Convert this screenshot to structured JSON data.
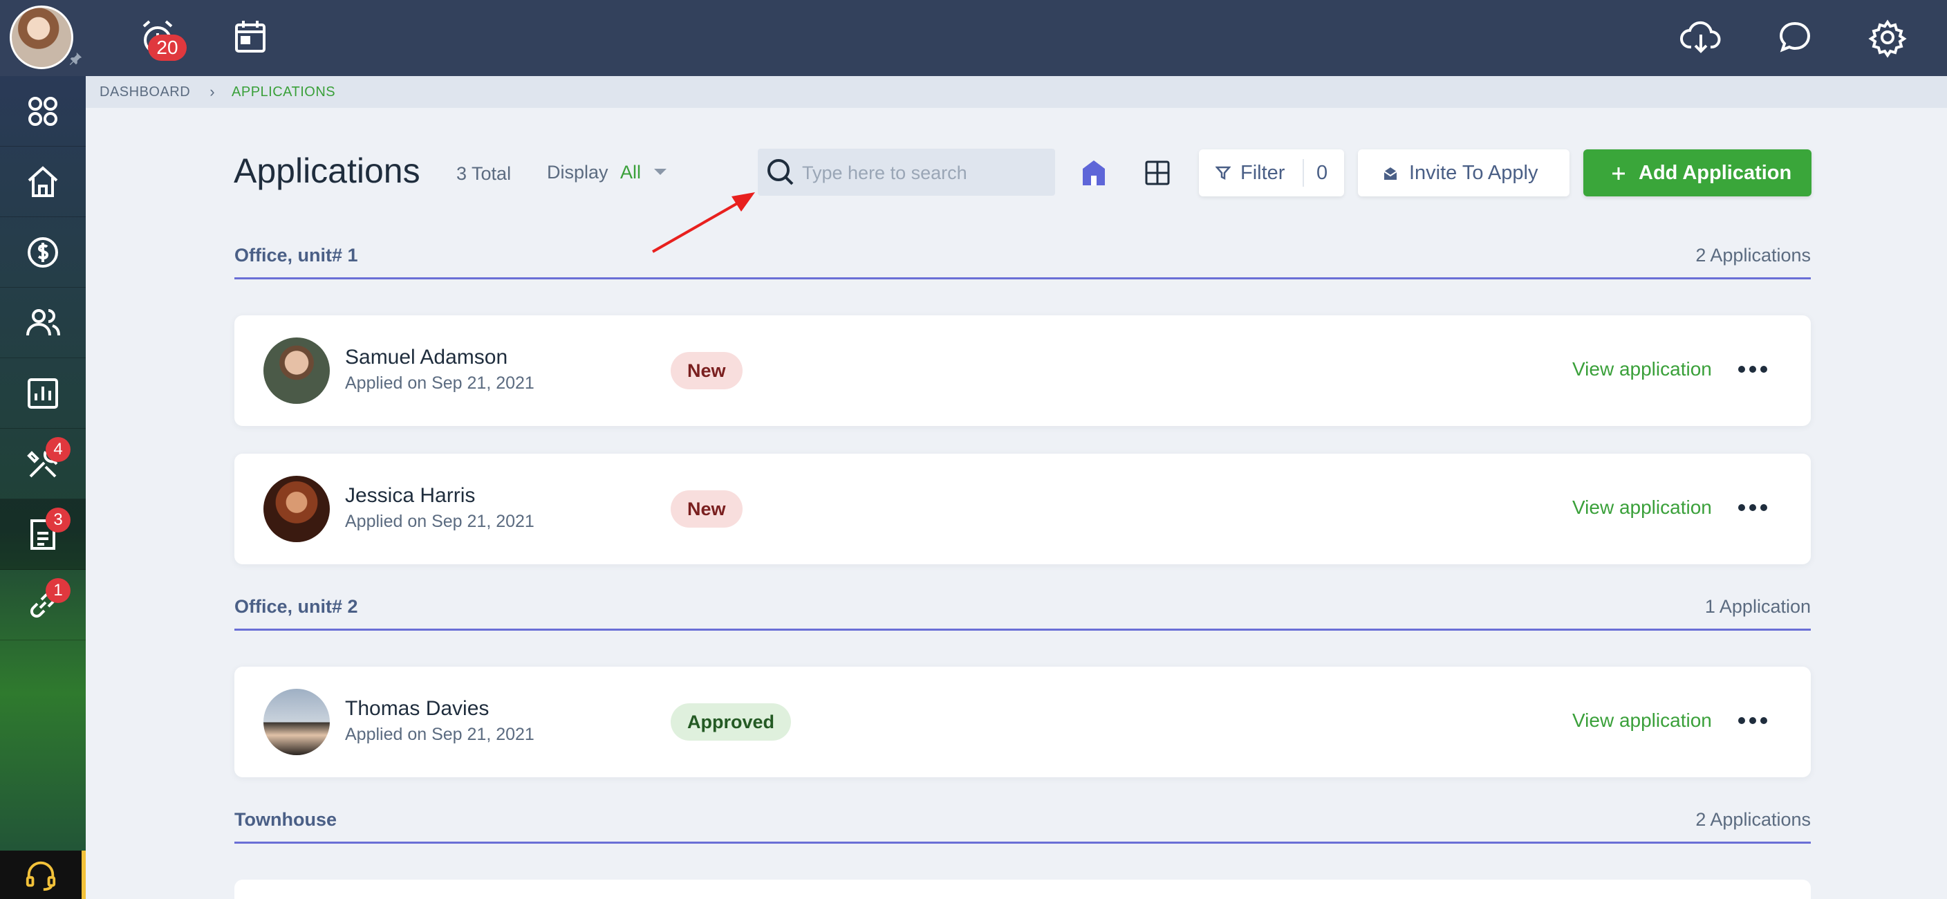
{
  "topbar": {
    "alarm_badge": "20",
    "icons": [
      "alarm-clock-icon",
      "calendar-icon",
      "cloud-download-icon",
      "chat-icon",
      "gear-icon"
    ]
  },
  "sidebar": {
    "items": [
      {
        "name": "apps-icon",
        "badge": ""
      },
      {
        "name": "home-icon",
        "badge": ""
      },
      {
        "name": "dollar-icon",
        "badge": ""
      },
      {
        "name": "users-icon",
        "badge": ""
      },
      {
        "name": "reports-icon",
        "badge": ""
      },
      {
        "name": "tools-icon",
        "badge": "4"
      },
      {
        "name": "document-icon",
        "badge": "3"
      },
      {
        "name": "link-icon",
        "badge": "1"
      }
    ]
  },
  "breadcrumb": {
    "items": [
      "DASHBOARD",
      "APPLICATIONS"
    ]
  },
  "header": {
    "title": "Applications",
    "total": "3 Total",
    "display_label": "Display",
    "display_value": "All",
    "search_placeholder": "Type here to search",
    "filter_label": "Filter",
    "filter_count": "0",
    "invite_label": "Invite To Apply",
    "add_label": "Add Application"
  },
  "groups": [
    {
      "title": "Office, unit# 1",
      "count": "2 Applications",
      "applications": [
        {
          "name": "Samuel Adamson",
          "applied": "Applied on Sep 21, 2021",
          "status": "New",
          "action": "View application"
        },
        {
          "name": "Jessica Harris",
          "applied": "Applied on Sep 21, 2021",
          "status": "New",
          "action": "View application"
        }
      ]
    },
    {
      "title": "Office, unit# 2",
      "count": "1 Application",
      "applications": [
        {
          "name": "Thomas Davies",
          "applied": "Applied on Sep 21, 2021",
          "status": "Approved",
          "action": "View application"
        }
      ]
    },
    {
      "title": "Townhouse",
      "count": "2 Applications",
      "applications": []
    }
  ],
  "colors": {
    "topbar": "#33415c",
    "accent_green": "#3aa63a",
    "group_line": "#6a6fd6",
    "badge_red": "#e0383e"
  }
}
